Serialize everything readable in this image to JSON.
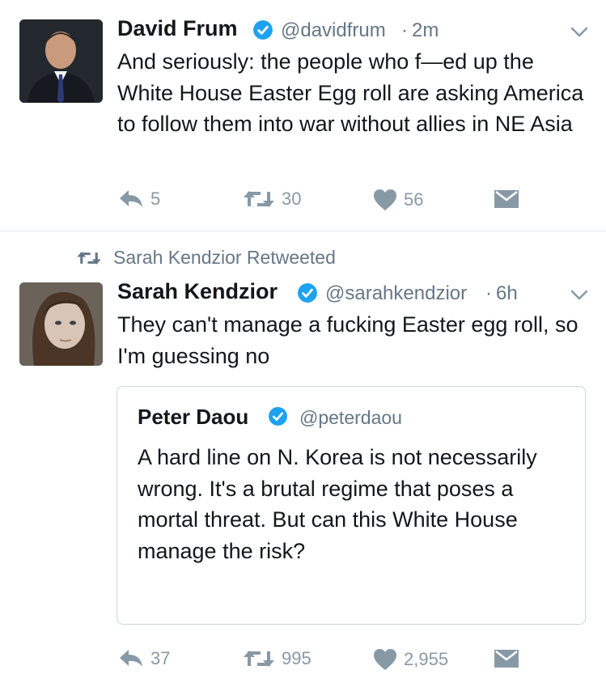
{
  "tweet1": {
    "name": "David Frum",
    "handle": "@davidfrum",
    "time": "2m",
    "text": "And seriously: the people who f—ed up the White House Easter Egg roll are asking America to follow them into war without allies in NE Asia",
    "replies": "5",
    "retweets": "30",
    "likes": "56",
    "avatar_icon": "man-in-suit-photo"
  },
  "retweet_context": {
    "label": "Sarah Kendzior Retweeted"
  },
  "tweet2": {
    "name": "Sarah Kendzior",
    "handle": "@sarahkendzior",
    "time": "6h",
    "text": "They can't manage a fucking Easter egg roll, so I'm guessing no",
    "replies": "37",
    "retweets": "995",
    "likes": "2,955",
    "avatar_icon": "woman-portrait-photo",
    "quote": {
      "name": "Peter Daou",
      "handle": "@peterdaou",
      "text": "A hard line on N. Korea is not necessarily wrong. It's a brutal regime that poses a mortal threat. But can this White House manage the risk?"
    }
  },
  "colors": {
    "verified": "#1da1f2",
    "muted": "#8899a6",
    "handle": "#657786",
    "divider": "#e1e8ed"
  }
}
